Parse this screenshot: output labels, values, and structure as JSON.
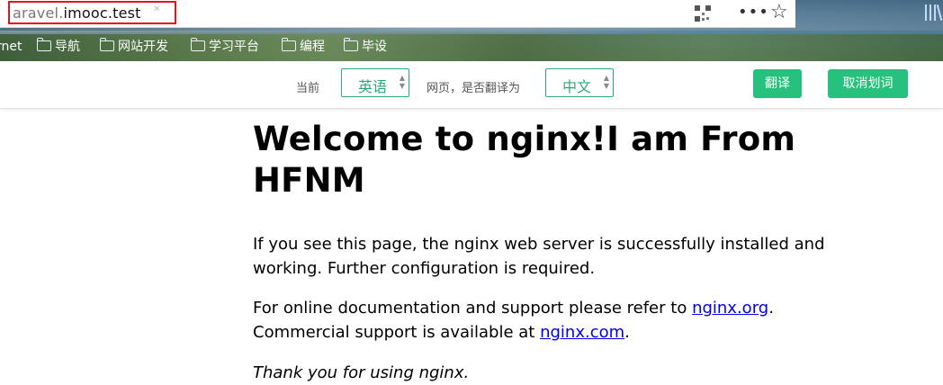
{
  "browser": {
    "url_prefix": "aravel.",
    "url_domain": "imooc.test",
    "icons": {
      "qr": "qr-code-icon",
      "more": "more-icon",
      "bookmark": "star-icon",
      "sidebar": "library-icon"
    },
    "bookmarks": [
      {
        "label": "rnet",
        "icon": null
      },
      {
        "label": "导航",
        "icon": "folder-icon"
      },
      {
        "label": "网站开发",
        "icon": "folder-icon"
      },
      {
        "label": "学习平台",
        "icon": "folder-icon"
      },
      {
        "label": "编程",
        "icon": "folder-icon"
      },
      {
        "label": "毕设",
        "icon": "folder-icon"
      }
    ]
  },
  "translate_bar": {
    "current_label": "当前",
    "source_lang": "英语",
    "question_label": "网页，是否翻译为",
    "target_lang": "中文",
    "translate_button": "翻译",
    "cancel_button": "取消划词",
    "accent_color": "#27c17e"
  },
  "page": {
    "heading": "Welcome to nginx!I am From HFNM",
    "para1": "If you see this page, the nginx web server is successfully installed and working. Further configuration is required.",
    "para2_prefix": "For online documentation and support please refer to ",
    "para2_link": "nginx.org",
    "para2_mid": ".",
    "para2_line2": "Commercial support is available at ",
    "para2_link2": "nginx.com",
    "para2_end": ".",
    "para3": "Thank you for using nginx."
  }
}
